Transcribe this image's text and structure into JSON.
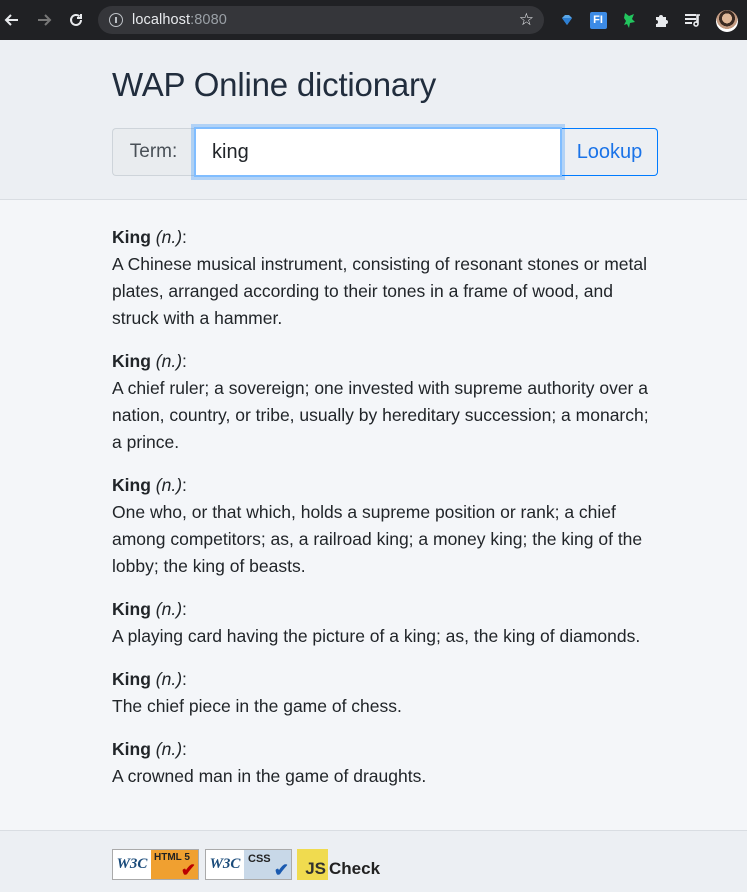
{
  "browser": {
    "url_host": "localhost",
    "url_port": ":8080"
  },
  "app": {
    "title": "WAP Online dictionary"
  },
  "search": {
    "addon_label": "Term:",
    "value": "king",
    "button_label": "Lookup"
  },
  "results": [
    {
      "word": "King",
      "pos": "(n.)",
      "colon": ":",
      "definition": "A Chinese musical instrument, consisting of resonant stones or metal plates, arranged according to their tones in a frame of wood, and struck with a hammer."
    },
    {
      "word": "King",
      "pos": "(n.)",
      "colon": ":",
      "definition": "A chief ruler; a sovereign; one invested with supreme authority over a nation, country, or tribe, usually by hereditary succession; a monarch; a prince."
    },
    {
      "word": "King",
      "pos": "(n.)",
      "colon": ":",
      "definition": "One who, or that which, holds a supreme position or rank; a chief among competitors; as, a railroad king; a money king; the king of the lobby; the king of beasts."
    },
    {
      "word": "King",
      "pos": "(n.)",
      "colon": ":",
      "definition": "A playing card having the picture of a king; as, the king of diamonds."
    },
    {
      "word": "King",
      "pos": "(n.)",
      "colon": ":",
      "definition": "The chief piece in the game of chess."
    },
    {
      "word": "King",
      "pos": "(n.)",
      "colon": ":",
      "definition": "A crowned man in the game of draughts."
    }
  ],
  "footer": {
    "html_badge": {
      "brand": "W3C",
      "kind": "HTML 5"
    },
    "css_badge": {
      "brand": "W3C",
      "kind": "CSS"
    },
    "js_badge": {
      "brand": "JS",
      "label": "Check"
    }
  }
}
